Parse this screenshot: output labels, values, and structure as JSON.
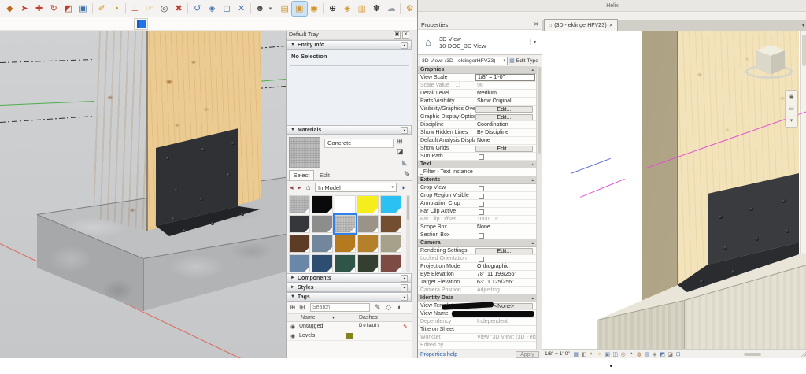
{
  "colors": {
    "accent_blue": "#2f80e8",
    "sketchup_viewport_bg": "#cbcccd",
    "wood": "#eccb92",
    "steel_plate": "#303134",
    "concrete": "#b2b3b5",
    "revit_wood": "#f3e3ba",
    "axis_red": "#e0685c",
    "axis_green": "#4fae4c",
    "line_magenta": "#e44fd5",
    "line_blue": "#5868d6"
  },
  "sketchup": {
    "toolbar": {
      "icons": [
        {
          "name": "push-pull-icon",
          "glyph": "◆",
          "color": "#c06a1f",
          "cls": ""
        },
        {
          "name": "follow-me-icon",
          "glyph": "➤",
          "color": "#c23b2c",
          "cls": ""
        },
        {
          "name": "move-icon",
          "glyph": "✚",
          "color": "#c23b2c",
          "cls": ""
        },
        {
          "name": "rotate-icon",
          "glyph": "↻",
          "color": "#c23b2c",
          "cls": ""
        },
        {
          "name": "scale-icon",
          "glyph": "◩",
          "color": "#c23b2c",
          "cls": ""
        },
        {
          "name": "offset-icon",
          "glyph": "▣",
          "color": "#3d6fa8",
          "cls": ""
        },
        {
          "cls": "sep"
        },
        {
          "name": "tape-measure-icon",
          "glyph": "✐",
          "color": "#d2942f",
          "cls": ""
        },
        {
          "name": "protractor-icon",
          "glyph": "◔",
          "color": "#d2942f",
          "cls": ""
        },
        {
          "cls": "sep"
        },
        {
          "name": "axes-icon",
          "glyph": "⊥",
          "color": "#c23b2c",
          "cls": ""
        },
        {
          "name": "dimension-icon",
          "glyph": "☞",
          "color": "#d2942f",
          "cls": ""
        },
        {
          "name": "zoom-icon",
          "glyph": "◎",
          "color": "#4a4a4a",
          "cls": ""
        },
        {
          "name": "zoom-extents-icon",
          "glyph": "✖",
          "color": "#c23b2c",
          "cls": ""
        },
        {
          "cls": "sep"
        },
        {
          "name": "orbit-icon",
          "glyph": "↺",
          "color": "#3d6fa8",
          "cls": ""
        },
        {
          "name": "pan-icon",
          "glyph": "◈",
          "color": "#3d6fa8",
          "cls": ""
        },
        {
          "name": "zoom-window-icon",
          "glyph": "◻",
          "color": "#3d6fa8",
          "cls": ""
        },
        {
          "name": "previous-view-icon",
          "glyph": "✕",
          "color": "#3d6fa8",
          "cls": ""
        },
        {
          "cls": "sep"
        },
        {
          "name": "account-icon",
          "glyph": "☻",
          "color": "#4f4f4f",
          "cls": ""
        },
        {
          "name": "account-caret-icon",
          "glyph": "▾",
          "color": "#666666",
          "cls": "narrow"
        },
        {
          "cls": "sep"
        },
        {
          "name": "layers-icon",
          "glyph": "▤",
          "color": "#d2942f",
          "cls": ""
        },
        {
          "name": "copy-icon",
          "glyph": "▣",
          "color": "#d2942f",
          "cls": "sel"
        },
        {
          "name": "position-camera-icon",
          "glyph": "◉",
          "color": "#d2942f",
          "cls": ""
        },
        {
          "cls": "sep"
        },
        {
          "name": "add-location-icon",
          "glyph": "⊕",
          "color": "#222222",
          "cls": ""
        },
        {
          "name": "shield-icon",
          "glyph": "◈",
          "color": "#d2942f",
          "cls": ""
        },
        {
          "name": "styles-book-icon",
          "glyph": "▥",
          "color": "#d2942f",
          "cls": ""
        },
        {
          "name": "extension-flower-icon",
          "glyph": "✽",
          "color": "#333333",
          "cls": ""
        },
        {
          "name": "cloud-upload-icon",
          "glyph": "☁",
          "color": "#9aa0a6",
          "cls": ""
        },
        {
          "cls": "sep"
        },
        {
          "name": "preferences-icon",
          "glyph": "⚙",
          "color": "#d2942f",
          "cls": ""
        }
      ]
    },
    "active_material": {
      "color": "#2173e8"
    },
    "tray": {
      "title": "Default Tray",
      "icons": {
        "dock": "▣",
        "close": "✕",
        "caret_open": "▼",
        "caret_closed": "►",
        "options": "▪"
      },
      "entity_info": {
        "label": "Entity Info",
        "content": "No Selection"
      },
      "materials": {
        "label": "Materials",
        "name": "Concrete",
        "icons": {
          "create": "⊞",
          "paint": "◪",
          "corner": "◣",
          "back": "◂",
          "fwd": "▸",
          "home": "⌂",
          "menu": "◑",
          "sample": "✎"
        },
        "tabs": {
          "select": "Select",
          "edit": "Edit"
        },
        "in_model": "In Model",
        "caret": "▾",
        "swatches": [
          {
            "name": "swatch-concrete",
            "color": "#bcbcbc",
            "cls": "tex"
          },
          {
            "name": "swatch-black",
            "color": "#0a0a0a",
            "cls": ""
          },
          {
            "name": "swatch-white",
            "color": "#ffffff",
            "cls": ""
          },
          {
            "name": "swatch-yellow",
            "color": "#f6ee1c",
            "cls": ""
          },
          {
            "name": "swatch-sky-blue",
            "color": "#2bc1f2",
            "cls": ""
          },
          {
            "name": "swatch-charcoal",
            "color": "#35373a",
            "cls": ""
          },
          {
            "name": "swatch-gray",
            "color": "#8d8d8d",
            "cls": ""
          },
          {
            "name": "swatch-concrete-selected",
            "color": "#c2c2c0",
            "cls": "tex on"
          },
          {
            "name": "swatch-taupe",
            "color": "#9b9288",
            "cls": ""
          },
          {
            "name": "swatch-brown",
            "color": "#744e31",
            "cls": ""
          },
          {
            "name": "swatch-dark-brown",
            "color": "#5d3b25",
            "cls": ""
          },
          {
            "name": "swatch-blue-gray",
            "color": "#72879b",
            "cls": ""
          },
          {
            "name": "swatch-ochre",
            "color": "#b5791e",
            "cls": ""
          },
          {
            "name": "swatch-amber",
            "color": "#b4812a",
            "cls": ""
          },
          {
            "name": "swatch-khaki",
            "color": "#a7a08b",
            "cls": ""
          },
          {
            "name": "swatch-steel-blue",
            "color": "#6b87a7",
            "cls": ""
          },
          {
            "name": "swatch-navy",
            "color": "#2d4e71",
            "cls": ""
          },
          {
            "name": "swatch-dark-teal",
            "color": "#2f5549",
            "cls": ""
          },
          {
            "name": "swatch-dark-green",
            "color": "#343f31",
            "cls": ""
          },
          {
            "name": "swatch-maroon",
            "color": "#7d4b44",
            "cls": ""
          }
        ]
      },
      "components": {
        "label": "Components"
      },
      "styles": {
        "label": "Styles"
      },
      "tags": {
        "label": "Tags",
        "icons": {
          "add": "⊕",
          "add_folder": "⊞",
          "pencil": "✎",
          "purge": "◇",
          "filter": "◐",
          "eye": "◉",
          "caret": "▾"
        },
        "search_placeholder": "Search",
        "columns": {
          "name": "Name",
          "dashes": "Dashes"
        },
        "rows": [
          {
            "name": "Untagged",
            "dashes": "Default",
            "action": "✎"
          },
          {
            "name": "Levels",
            "color": "#84841f",
            "dashes": "—··—··—"
          }
        ]
      }
    }
  },
  "revit": {
    "window_title": "Helix",
    "properties": {
      "title": "Properties",
      "close": "✕",
      "type": {
        "icon": "⌂",
        "line1": "3D View",
        "line2": "10-DOC_3D View",
        "caret": "▾"
      },
      "selector": {
        "value": "3D View: (3D - eklingerHFVZ3)",
        "caret": "▾"
      },
      "edit_type": {
        "icon": "▦",
        "label": "Edit Type"
      },
      "section_caret": "▴",
      "rows": [
        {
          "cls": "sec",
          "label": "Graphics"
        },
        {
          "cls": "",
          "label": "View Scale",
          "value": "1/8\" = 1'-0\"",
          "vcls": "field"
        },
        {
          "cls": "dim",
          "label": "Scale Value    1:",
          "value": "96",
          "vcls": "dim"
        },
        {
          "cls": "",
          "label": "Detail Level",
          "value": "Medium",
          "vcls": ""
        },
        {
          "cls": "",
          "label": "Parts Visibility",
          "value": "Show Original",
          "vcls": ""
        },
        {
          "cls": "",
          "label": "Visibility/Graphics Overri...",
          "value": "Edit...",
          "vcls": "btn"
        },
        {
          "cls": "",
          "label": "Graphic Display Options",
          "value": "Edit...",
          "vcls": "btn"
        },
        {
          "cls": "",
          "label": "Discipline",
          "value": "Coordination",
          "vcls": ""
        },
        {
          "cls": "",
          "label": "Show Hidden Lines",
          "value": "By Discipline",
          "vcls": ""
        },
        {
          "cls": "",
          "label": "Default Analysis Display ...",
          "value": "None",
          "vcls": ""
        },
        {
          "cls": "",
          "label": "Show Grids",
          "value": "Edit...",
          "vcls": "btn"
        },
        {
          "cls": "",
          "label": "Sun Path",
          "value": "",
          "vcls": "chk"
        },
        {
          "cls": "sec",
          "label": "Text"
        },
        {
          "cls": "",
          "label": "_Filter - Text Instance",
          "value": "",
          "vcls": ""
        },
        {
          "cls": "sec",
          "label": "Extents"
        },
        {
          "cls": "",
          "label": "Crop View",
          "value": "",
          "vcls": "chk"
        },
        {
          "cls": "",
          "label": "Crop Region Visible",
          "value": "",
          "vcls": "chk"
        },
        {
          "cls": "",
          "label": "Annotation Crop",
          "value": "",
          "vcls": "chk"
        },
        {
          "cls": "",
          "label": "Far Clip Active",
          "value": "",
          "vcls": "chk"
        },
        {
          "cls": "dim",
          "label": "Far Clip Offset",
          "value": "1000'  0\"",
          "vcls": "dim"
        },
        {
          "cls": "",
          "label": "Scope Box",
          "value": "None",
          "vcls": ""
        },
        {
          "cls": "",
          "label": "Section Box",
          "value": "",
          "vcls": "chk"
        },
        {
          "cls": "sec",
          "label": "Camera"
        },
        {
          "cls": "",
          "label": "Rendering Settings",
          "value": "Edit...",
          "vcls": "btn"
        },
        {
          "cls": "dim",
          "label": "Locked Orientation",
          "value": "",
          "vcls": "chk"
        },
        {
          "cls": "",
          "label": "Projection Mode",
          "value": "Orthographic",
          "vcls": ""
        },
        {
          "cls": "",
          "label": "Eye Elevation",
          "value": "78'  11 193/256\"",
          "vcls": ""
        },
        {
          "cls": "",
          "label": "Target Elevation",
          "value": "63'  1 125/256\"",
          "vcls": ""
        },
        {
          "cls": "dim",
          "label": "Camera Position",
          "value": "Adjusting",
          "vcls": "dim"
        },
        {
          "cls": "sec",
          "label": "Identity Data"
        },
        {
          "cls": "scr",
          "label": "View Template",
          "value": "<None>",
          "vcls": "btn"
        },
        {
          "cls": "",
          "label": "View Name",
          "value": "",
          "vcls": "redact"
        },
        {
          "cls": "dim",
          "label": "Dependency",
          "value": "Independent",
          "vcls": "dim"
        },
        {
          "cls": "",
          "label": "Title on Sheet",
          "value": "",
          "vcls": ""
        },
        {
          "cls": "dim",
          "label": "Workset",
          "value": "View \"3D View: (3D - ekli...",
          "vcls": "dim"
        },
        {
          "cls": "dim",
          "label": "Edited by",
          "value": "",
          "vcls": ""
        }
      ],
      "help_link": "Properties help",
      "apply_label": "Apply"
    },
    "tab": {
      "icon": "⌂",
      "label": "(3D - eklingerHFVZ3)",
      "close": "✕",
      "list_icon": "▾"
    },
    "bottom_bar": {
      "scale": "1/8\" = 1'-0\"",
      "icons": [
        {
          "name": "visual-style-icon",
          "glyph": "▦",
          "color": "#5f80a6"
        },
        {
          "name": "render-dialog-icon",
          "glyph": "◧",
          "color": "#8a8276"
        },
        {
          "name": "shadows-icon",
          "glyph": "◐",
          "color": "#b08a3e"
        },
        {
          "name": "sun-path-icon",
          "glyph": "☼",
          "color": "#c79b3a"
        },
        {
          "name": "crop-view-icon",
          "glyph": "▣",
          "color": "#5f80a6"
        },
        {
          "name": "show-crop-icon",
          "glyph": "◫",
          "color": "#5f80a6"
        },
        {
          "name": "lock-view-icon",
          "glyph": "◎",
          "color": "#8a8276"
        },
        {
          "name": "hide-isolate-icon",
          "glyph": "◔",
          "color": "#6a6660"
        },
        {
          "name": "reveal-hidden-icon",
          "glyph": "◍",
          "color": "#b0712e"
        },
        {
          "name": "view-properties-icon",
          "glyph": "▤",
          "color": "#5f80a6"
        },
        {
          "name": "displacement-icon",
          "glyph": "◈",
          "color": "#8a8276"
        },
        {
          "name": "analytical-icon",
          "glyph": "◩",
          "color": "#5f80a6"
        },
        {
          "name": "worksharing-icon",
          "glyph": "◪",
          "color": "#8a8276"
        },
        {
          "name": "guide-grid-icon",
          "glyph": "⊡",
          "color": "#5f80a6"
        }
      ]
    }
  }
}
